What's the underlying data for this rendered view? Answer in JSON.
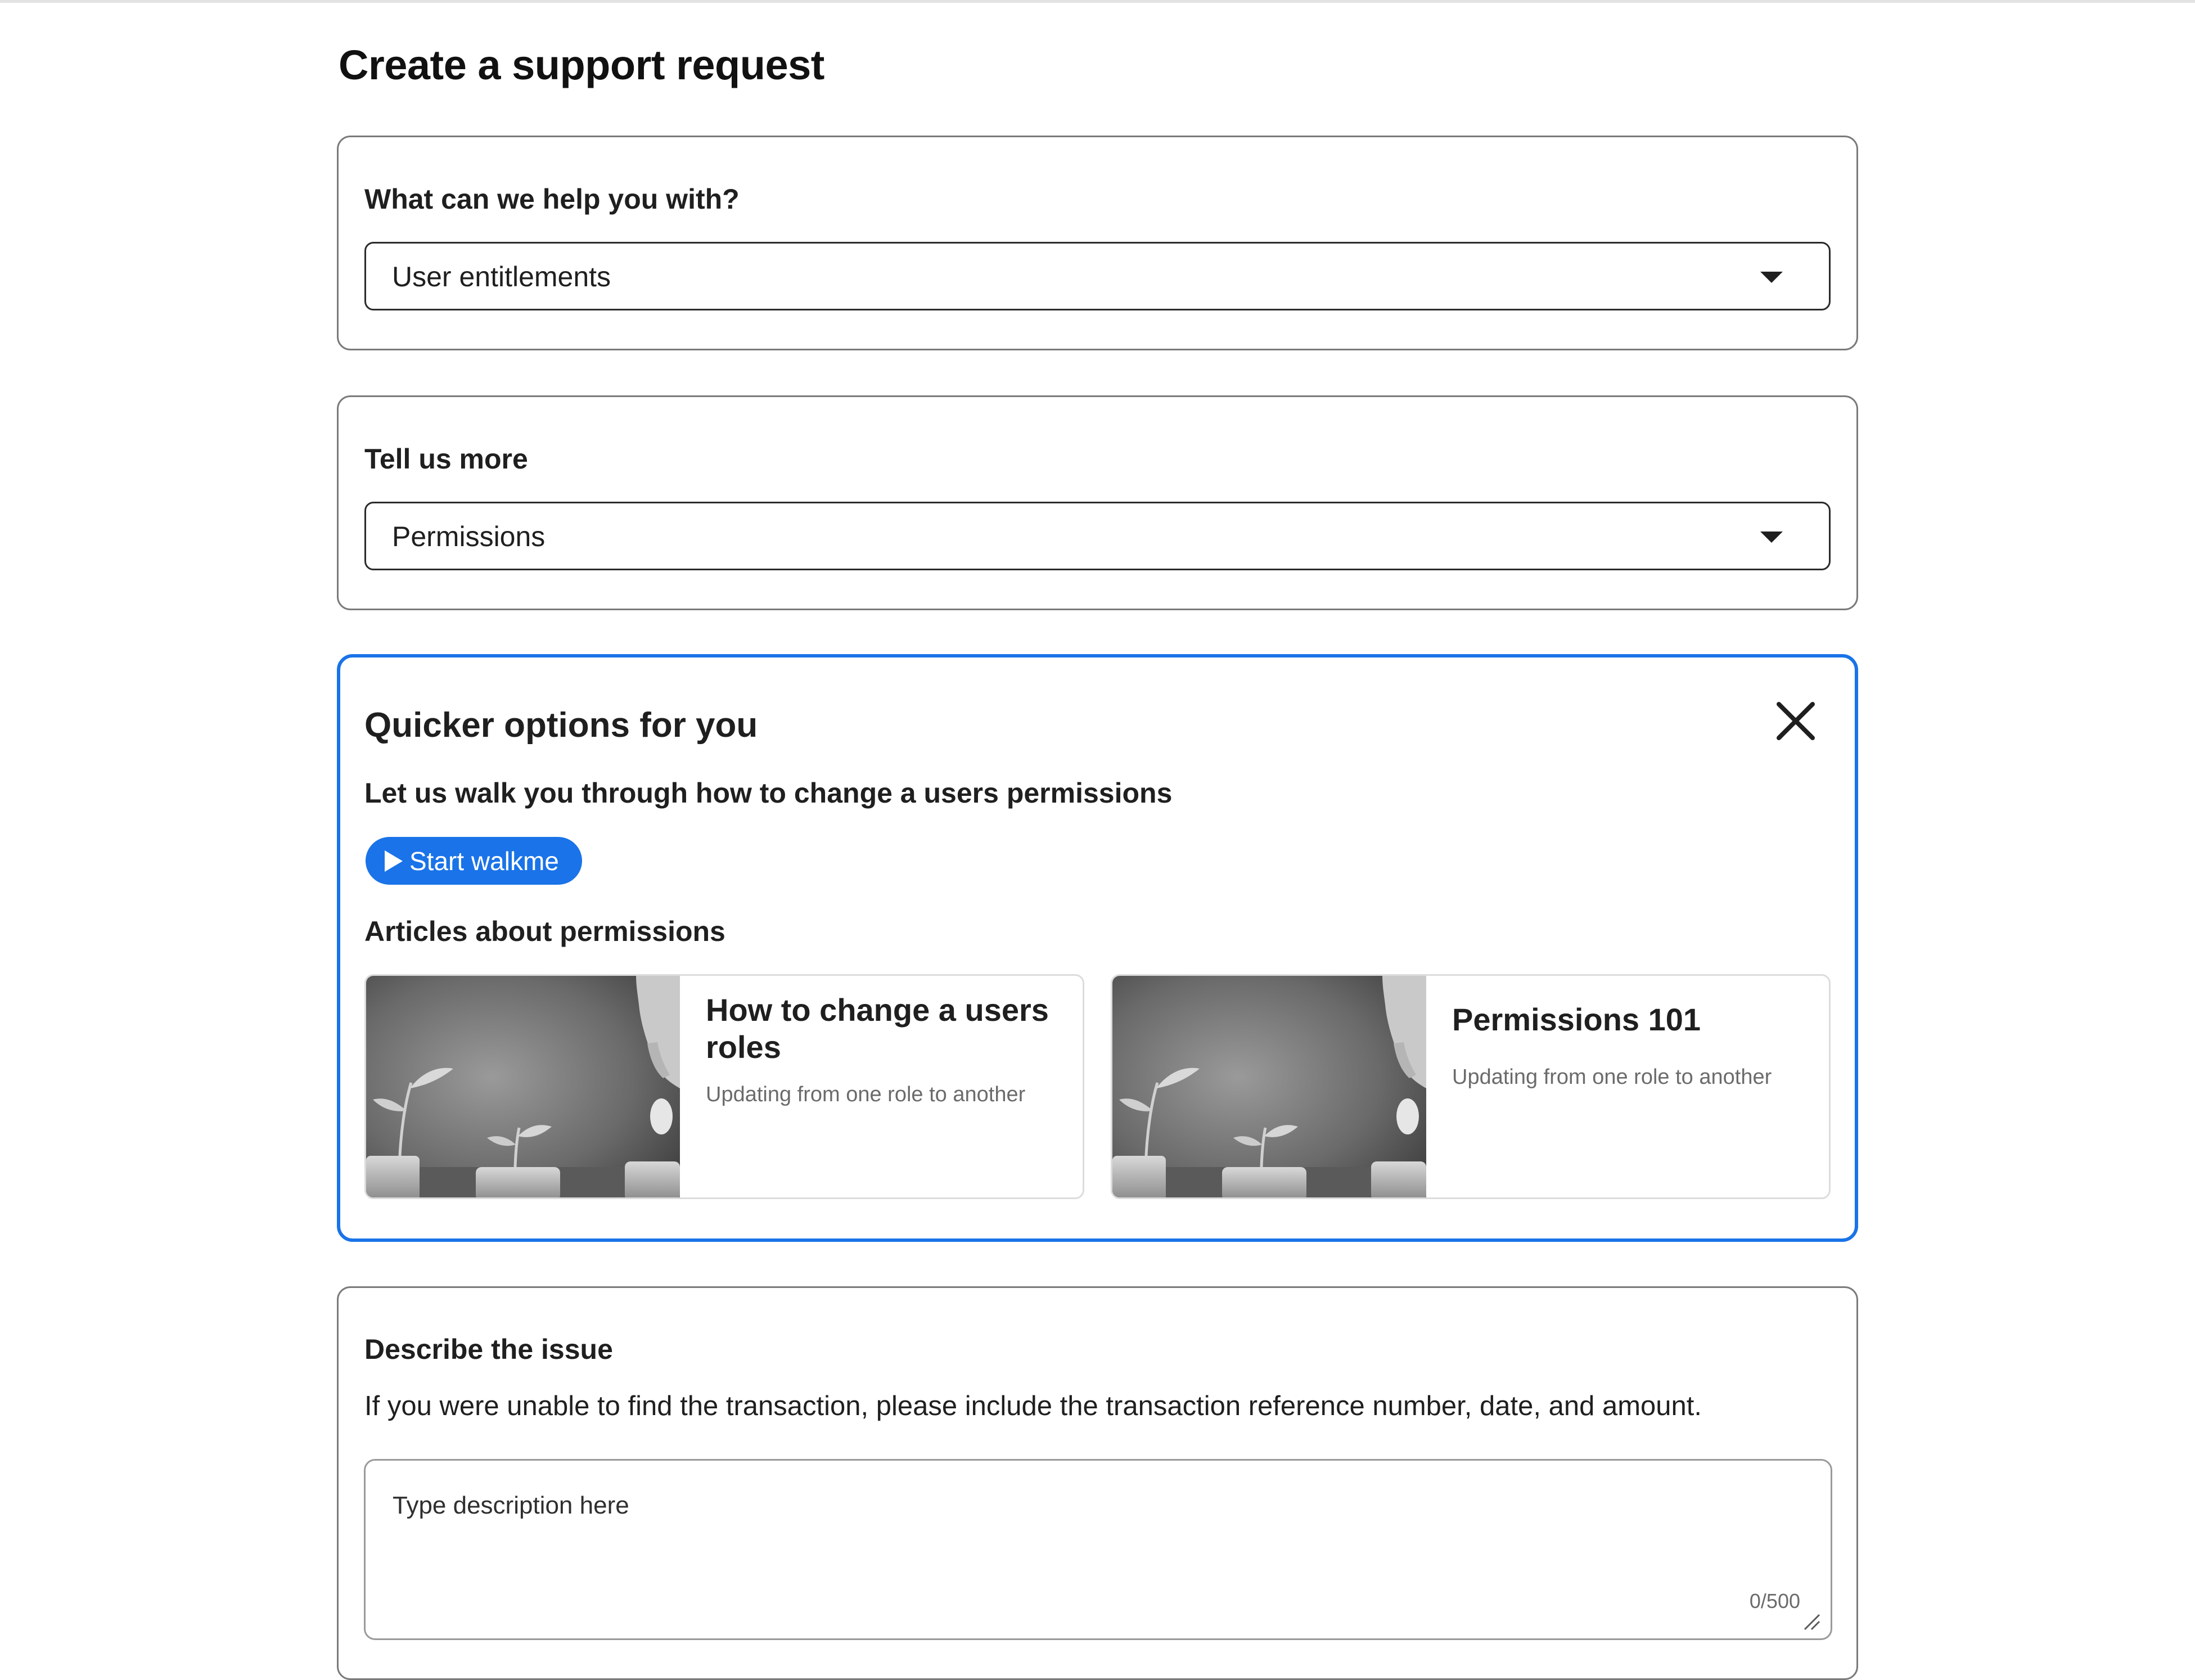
{
  "page": {
    "title": "Create a support request"
  },
  "help_topic": {
    "label": "What can we help you with?",
    "selected": "User entitlements"
  },
  "details": {
    "label": "Tell us more",
    "selected": "Permissions"
  },
  "quicker_options": {
    "title": "Quicker options for you",
    "subtitle": "Let us walk you through how to change a users permissions",
    "walkme_label": "Start walkme",
    "articles_heading": "Articles about permissions",
    "articles": [
      {
        "title": "How to change a users roles",
        "description": "Updating from one role to another",
        "image": "plants-growing-from-coin-jars-photo"
      },
      {
        "title": "Permissions 101",
        "description": "Updating from one role to another",
        "image": "plants-growing-from-coin-jars-photo"
      }
    ]
  },
  "describe": {
    "label": "Describe the issue",
    "help_text": "If you were unable to find the transaction, please include the transaction reference number, date, and amount.",
    "placeholder": "Type description here",
    "counter": "0/500"
  },
  "colors": {
    "accent": "#1a73e8",
    "border": "#7a7a7a",
    "text": "#1f1f1f",
    "muted_text": "#6b6b6b"
  },
  "icons": {
    "select_caret": "caret-down-icon",
    "close": "close-icon",
    "walkme": "play-icon",
    "resize": "resize-handle-icon"
  }
}
